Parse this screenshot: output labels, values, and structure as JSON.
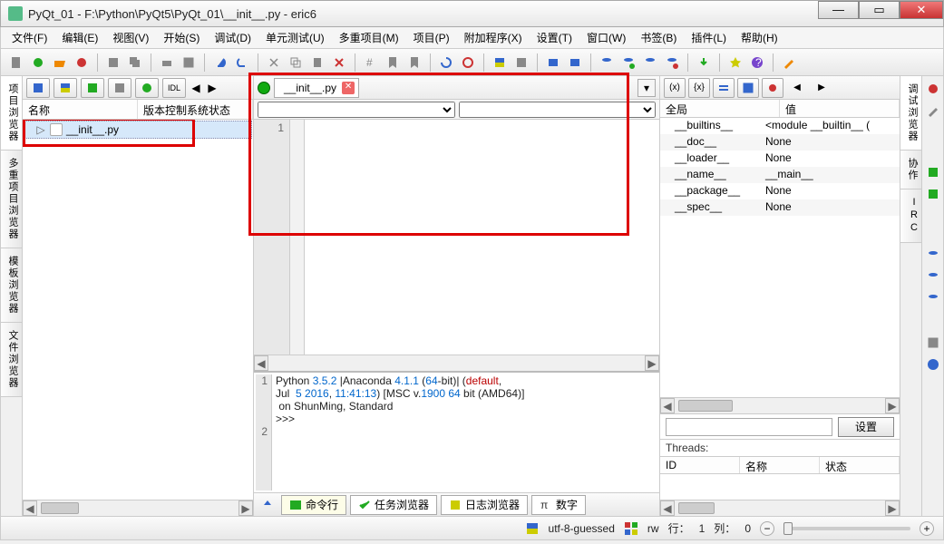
{
  "window": {
    "title": "PyQt_01 - F:\\Python\\PyQt5\\PyQt_01\\__init__.py - eric6"
  },
  "menus": {
    "file": "文件(F)",
    "edit": "编辑(E)",
    "view": "视图(V)",
    "start": "开始(S)",
    "debug": "调试(D)",
    "unittest": "单元测试(U)",
    "multiproject": "多重项目(M)",
    "project": "项目(P)",
    "extras": "附加程序(X)",
    "settings": "设置(T)",
    "window": "窗口(W)",
    "bookmarks": "书签(B)",
    "plugins": "插件(L)",
    "help": "帮助(H)"
  },
  "sidetabs": {
    "left": [
      "项目浏览器",
      "多重项目浏览器",
      "模板浏览器",
      "文件浏览器"
    ],
    "right": [
      "调试浏览器",
      "协作",
      "IRC"
    ]
  },
  "projectview": {
    "col_name": "名称",
    "col_vcs": "版本控制系统状态",
    "file": "__init__.py"
  },
  "editor": {
    "tabname": "__init__.py",
    "line1": "1"
  },
  "console": {
    "lines": [
      "1",
      "2"
    ],
    "text_parts": {
      "p1": "Python ",
      "ver": "3.5.2",
      "p2": " |Anaconda ",
      "aver": "4.1.1",
      "p3": " (",
      "bits": "64",
      "p4": "-bit)| (",
      "kw_default": "default",
      "p5": ",\nJul  ",
      "date": "5 2016",
      "p6": ", ",
      "time": "11:41:13",
      "p7": ") [MSC v.",
      "msc": "1900 64",
      "p8": " bit (AMD64)]\n on ShunMing, Standard"
    },
    "prompt": ">>> "
  },
  "bottomtabs": {
    "cmd": "命令行",
    "taskbrowser": "任务浏览器",
    "logbrowser": "日志浏览器",
    "numbers": "数字"
  },
  "debugger": {
    "col_global": "全局",
    "col_value": "值",
    "vars": [
      {
        "name": "__builtins__",
        "value": "<module __builtin__ ("
      },
      {
        "name": "__doc__",
        "value": "None"
      },
      {
        "name": "__loader__",
        "value": "None"
      },
      {
        "name": "__name__",
        "value": "__main__"
      },
      {
        "name": "__package__",
        "value": "None"
      },
      {
        "name": "__spec__",
        "value": "None"
      }
    ],
    "settings_btn": "设置",
    "threads_label": "Threads:",
    "thread_cols": {
      "id": "ID",
      "name": "名称",
      "state": "状态"
    }
  },
  "status": {
    "encoding": "utf-8-guessed",
    "mode": "rw",
    "row_label": "行：",
    "row_val": "1",
    "col_label": "列：",
    "col_val": "0"
  }
}
